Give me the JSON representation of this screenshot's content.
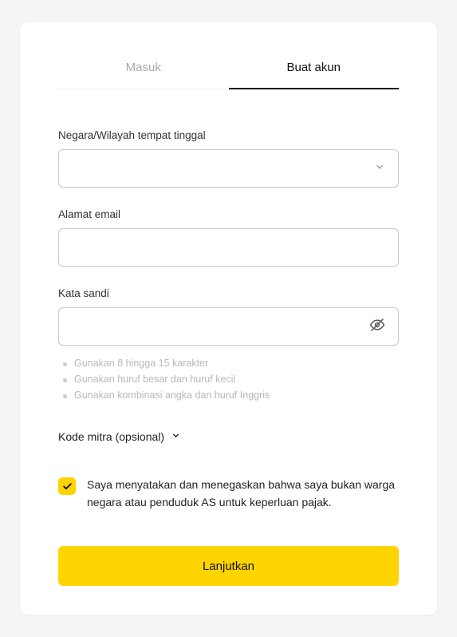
{
  "tabs": {
    "login": "Masuk",
    "signup": "Buat akun"
  },
  "fields": {
    "country_label": "Negara/Wilayah tempat tinggal",
    "email_label": "Alamat email",
    "password_label": "Kata sandi"
  },
  "password_hints": [
    "Gunakan 8 hingga 15 karakter",
    "Gunakan huruf besar dan huruf kecil",
    "Gunakan kombinasi angka dan huruf Inggris"
  ],
  "partner_code_label": "Kode mitra (opsional)",
  "tax_declaration": "Saya menyatakan dan menegaskan bahwa saya bukan warga negara atau penduduk AS untuk keperluan pajak.",
  "submit_label": "Lanjutkan"
}
